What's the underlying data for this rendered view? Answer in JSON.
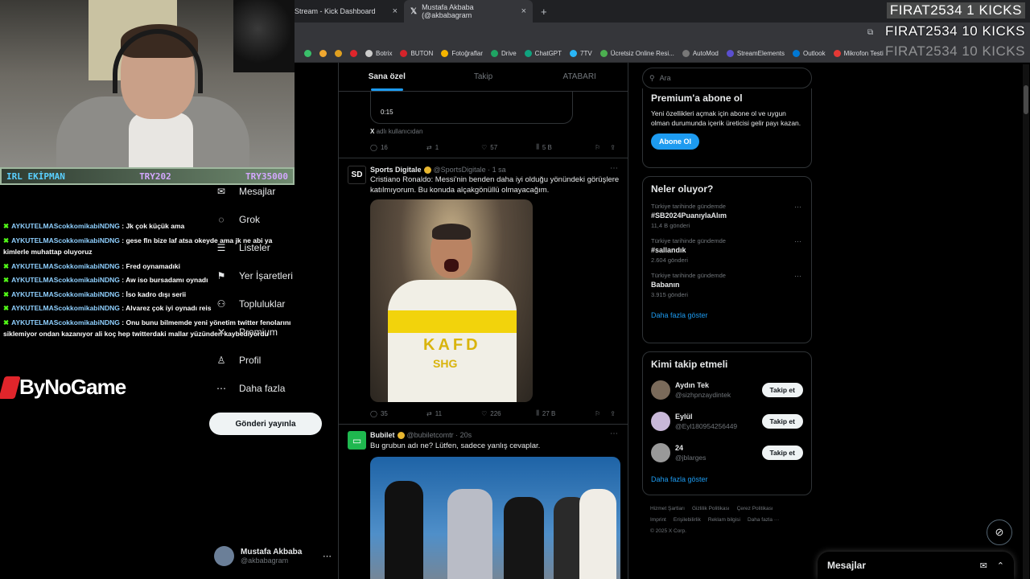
{
  "browser": {
    "tabs": [
      {
        "label": "Stream - Kick Dashboard",
        "close": "×"
      },
      {
        "label": "Mustafa Akbaba (@akbabagram",
        "close": "×"
      }
    ],
    "new_tab": "+",
    "bookmarks": [
      "Botrix",
      "BUTON",
      "Fotoğraflar",
      "Drive",
      "ChatGPT",
      "7TV",
      "Ücretsiz Online Resi...",
      "AutoMod",
      "StreamElements",
      "Outlook",
      "Mikrofon Testi"
    ]
  },
  "overlay": {
    "kicks_1": "FIRAT2534  1 KICKS",
    "kicks_2": "FIRAT2534  10 KICKS",
    "kicks_3": "FIRAT2534  10 KICKS",
    "prices": [
      "IRL EKİPMAN",
      "TRY202",
      "TRY35000"
    ],
    "brand": "ByNoGame"
  },
  "chat": [
    {
      "user": "AYKUTELMAScokkomikabiNDNG",
      "msg": " : Jk çok küçük ama"
    },
    {
      "user": "AYKUTELMAScokkomikabiNDNG",
      "msg": " : gese fln bize laf atsa okeyde ama jk ne abi ya kimlerle muhattap oluyoruz"
    },
    {
      "user": "AYKUTELMAScokkomikabiNDNG",
      "msg": " : Fred oynamadıki"
    },
    {
      "user": "AYKUTELMAScokkomikabiNDNG",
      "msg": " : Aw iso bursadamı oynadı"
    },
    {
      "user": "AYKUTELMAScokkomikabiNDNG",
      "msg": " : İso kadro dışı serii"
    },
    {
      "user": "AYKUTELMAScokkomikabiNDNG",
      "msg": " : Alvarez çok iyi oynadı reis"
    },
    {
      "user": "AYKUTELMAScokkomikabiNDNG",
      "msg": " : Onu bunu bilmemde yeni yönetim twitter fenolarını siklemiyor ondan kazanıyor ali koç hep twitterdaki mallar yüzünden kaybediyordu"
    }
  ],
  "nav": {
    "items": [
      {
        "label": "Mesajlar",
        "icon": "✉"
      },
      {
        "label": "Grok",
        "icon": "◌"
      },
      {
        "label": "Listeler",
        "icon": "☰"
      },
      {
        "label": "Yer İşaretleri",
        "icon": "⚑"
      },
      {
        "label": "Topluluklar",
        "icon": "⚇"
      },
      {
        "label": "Premium",
        "icon": "✕"
      },
      {
        "label": "Profil",
        "icon": "♙"
      },
      {
        "label": "Daha fazla",
        "icon": "⋯"
      }
    ],
    "post_button": "Gönderi yayınla",
    "me_name": "Mustafa Akbaba",
    "me_handle": "@akbabagram",
    "more": "⋯"
  },
  "timeline": {
    "tabs": [
      "Sana özel",
      "Takip",
      "ATABARI"
    ],
    "prev": {
      "duration": "0:15",
      "via_x": "X",
      "via": "adlı kullanıcıdan",
      "replies": "16",
      "reposts": "1",
      "likes": "57",
      "views": "5 B"
    },
    "tweet1": {
      "avatar": "SD",
      "name": "Sports Digitale",
      "handle": "@SportsDigitale · 1 sa",
      "text": "Cristiano Ronaldo: Messi'nin benden daha iyi olduğu yönündeki görüşlere katılmıyorum. Bu konuda alçakgönüllü olmayacağım.",
      "jersey_main": "KAFD",
      "jersey_sub": "SHG",
      "replies": "35",
      "reposts": "11",
      "likes": "226",
      "views": "27 B"
    },
    "tweet2": {
      "name": "Bubilet",
      "handle": "@bubiletcomtr · 20s",
      "text": "Bu grubun adı ne? Lütfen, sadece yanlış cevaplar."
    }
  },
  "sidebar": {
    "search_placeholder": "Ara",
    "premium": {
      "title": "Premium'a abone ol",
      "text": "Yeni özellikleri açmak için abone ol ve uygun olman durumunda içerik üreticisi gelir payı kazan.",
      "button": "Abone Ol"
    },
    "trends": {
      "title": "Neler oluyor?",
      "items": [
        {
          "context": "Türkiye tarihinde gündemde",
          "topic": "#SB2024PuanıylaAlım",
          "count": "11,4 B gönderi"
        },
        {
          "context": "Türkiye tarihinde gündemde",
          "topic": "#sallandık",
          "count": "2.604 gönderi"
        },
        {
          "context": "Türkiye tarihinde gündemde",
          "topic": "Babanın",
          "count": "3.915 gönderi"
        }
      ],
      "more": "Daha fazla göster"
    },
    "who": {
      "title": "Kimi takip etmeli",
      "items": [
        {
          "name": "Aydın Tek",
          "handle": "@sizhpnzaydintek",
          "button": "Takip et"
        },
        {
          "name": "Eylül",
          "handle": "@Eyl180954256449",
          "button": "Takip et"
        },
        {
          "name": "24",
          "handle": "@jblarges",
          "button": "Takip et"
        }
      ],
      "more": "Daha fazla göster"
    },
    "footer": [
      "Hizmet Şartları",
      "Gizlilik Politikası",
      "Çerez Politikası",
      "Imprint",
      "Erişilebilirlik",
      "Reklam bilgisi",
      "Daha fazla ···",
      "© 2025 X Corp."
    ]
  },
  "dock": {
    "label": "Mesajlar"
  }
}
